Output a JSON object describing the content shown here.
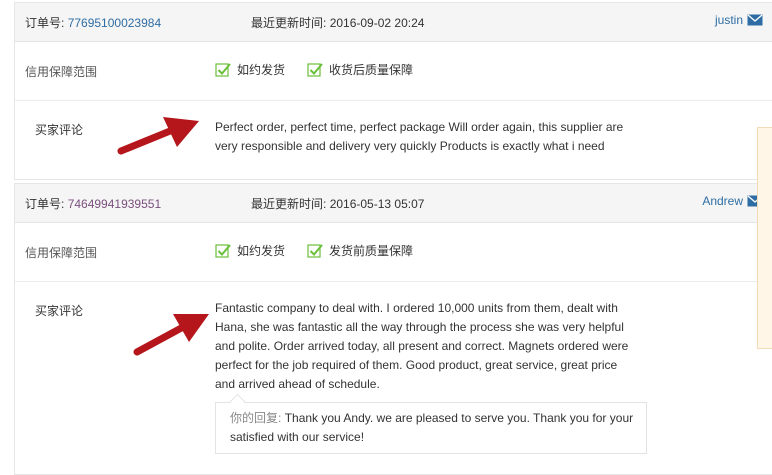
{
  "orders": [
    {
      "order_label": "订单号:",
      "order_number": "77695100023984",
      "updated_label": "最近更新时间:",
      "updated_time": "2016-09-02 20:24",
      "buyer": "justin",
      "guarantee_label": "信用保障范围",
      "guarantees": [
        "如约发货",
        "收货后质量保障"
      ],
      "comment_label": "买家评论",
      "comment": "Perfect order, perfect time, perfect package Will order again, this supplier are very responsible and delivery very quickly Products is exactly what i need"
    },
    {
      "order_label": "订单号:",
      "order_number": "74649941939551",
      "updated_label": "最近更新时间:",
      "updated_time": "2016-05-13 05:07",
      "buyer": "Andrew",
      "guarantee_label": "信用保障范围",
      "guarantees": [
        "如约发货",
        "发货前质量保障"
      ],
      "comment_label": "买家评论",
      "comment": "Fantastic company to deal with. I ordered 10,000 units from them, dealt with Hana, she was fantastic all the way through the process she was very helpful and polite. Order arrived today, all present and correct. Magnets ordered were perfect for the job required of them. Good product, great service, great price and arrived ahead of schedule.",
      "reply_label": "你的回复:",
      "reply": "Thank you Andy. we are pleased to serve you. Thank you for your satisfied with our service!"
    }
  ],
  "colors": {
    "link": "#2e6da4",
    "arrow": "#b5161c",
    "check": "#6abf3a"
  }
}
